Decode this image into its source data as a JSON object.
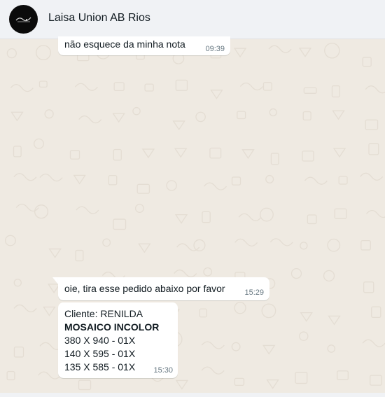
{
  "header": {
    "contact_name": "Laisa Union AB Rios"
  },
  "messages": [
    {
      "text": "não esquece da minha nota",
      "time": "09:39"
    },
    {
      "text": "oie, tira esse pedido abaixo por favor",
      "time": "15:29"
    },
    {
      "lines": {
        "client": "Cliente: RENILDA",
        "product": "MOSAICO INCOLOR",
        "size1": "380 X 940 - 01X",
        "size2": "140 X 595 - 01X",
        "size3": "135 X 585 - 01X"
      },
      "time": "15:30"
    }
  ],
  "colors": {
    "chat_background": "#efeae2",
    "bubble_background": "#ffffff",
    "header_background": "#f0f2f5",
    "timestamp": "#667781"
  }
}
